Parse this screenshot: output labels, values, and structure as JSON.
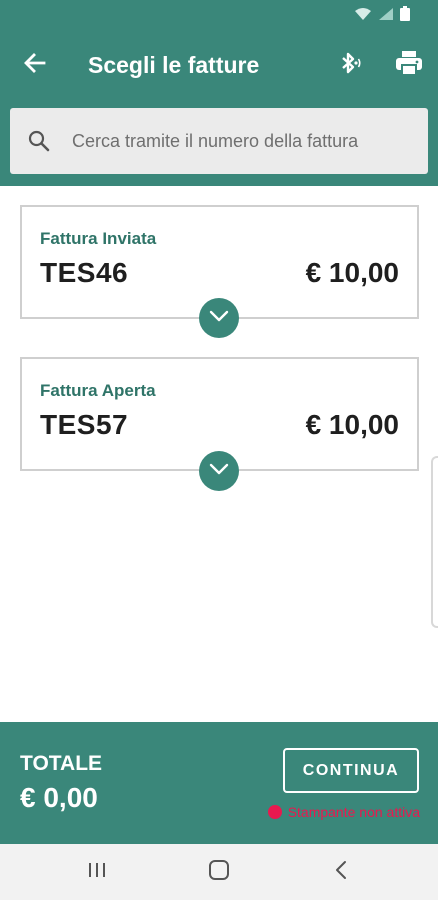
{
  "app_bar": {
    "title": "Scegli le fatture"
  },
  "search": {
    "placeholder": "Cerca tramite il numero della fattura",
    "value": ""
  },
  "invoices": [
    {
      "status": "Fattura Inviata",
      "number": "TES46",
      "amount": "€ 10,00"
    },
    {
      "status": "Fattura Aperta",
      "number": "TES57",
      "amount": "€ 10,00"
    }
  ],
  "footer": {
    "total_label": "TOTALE",
    "total_value": "€ 0,00",
    "continue_label": "CONTINUA",
    "printer_status": "Stampante non attiva"
  },
  "icons": {
    "status": [
      "wifi-icon",
      "signal-icon",
      "battery-icon"
    ],
    "app_bar": [
      "back-arrow-icon",
      "bluetooth-icon",
      "printer-icon"
    ],
    "search": "search-icon",
    "expand": "chevron-down-icon",
    "nav": [
      "recent-apps-icon",
      "home-icon",
      "back-icon"
    ]
  },
  "colors": {
    "primary": "#3a877a",
    "status_accent": "#2f7468",
    "error": "#e8194f",
    "card_border": "#cfcfcf",
    "nav_bar": "#f2f2f2"
  }
}
